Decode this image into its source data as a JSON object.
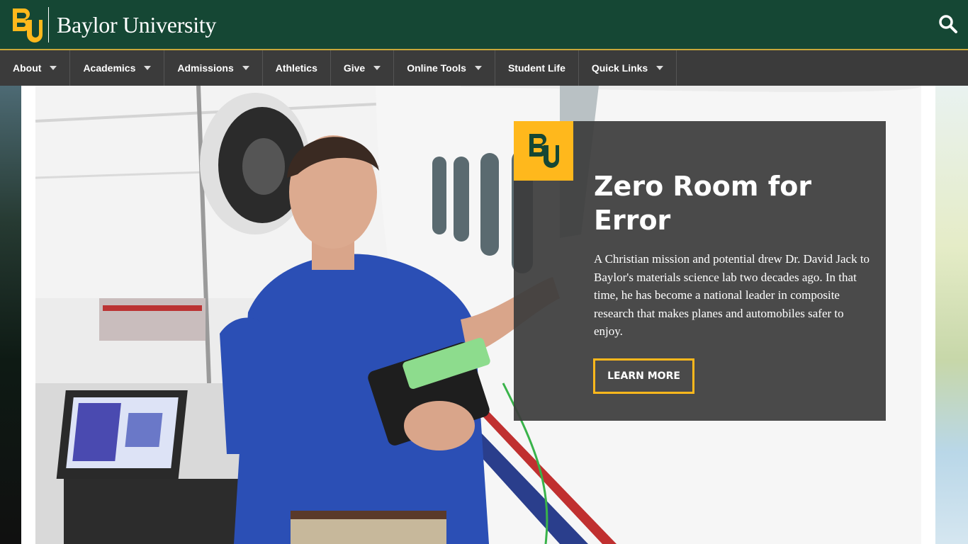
{
  "header": {
    "brand_name": "Baylor University",
    "logo_alt": "BU",
    "search_icon": "search-icon",
    "colors": {
      "green": "#154734",
      "gold": "#ffb81c"
    }
  },
  "nav": {
    "items": [
      {
        "label": "About",
        "has_dropdown": true
      },
      {
        "label": "Academics",
        "has_dropdown": true
      },
      {
        "label": "Admissions",
        "has_dropdown": true
      },
      {
        "label": "Athletics",
        "has_dropdown": false
      },
      {
        "label": "Give",
        "has_dropdown": true
      },
      {
        "label": "Online Tools",
        "has_dropdown": true
      },
      {
        "label": "Student Life",
        "has_dropdown": false
      },
      {
        "label": "Quick Links",
        "has_dropdown": true
      }
    ]
  },
  "hero": {
    "title": "Zero Room for Error",
    "body": "A Christian mission and potential drew Dr. David Jack to Baylor's materials science lab two decades ago. In that time, he has become a national leader in composite research that makes planes and automobiles safer to enjoy.",
    "button_label": "LEARN MORE"
  }
}
